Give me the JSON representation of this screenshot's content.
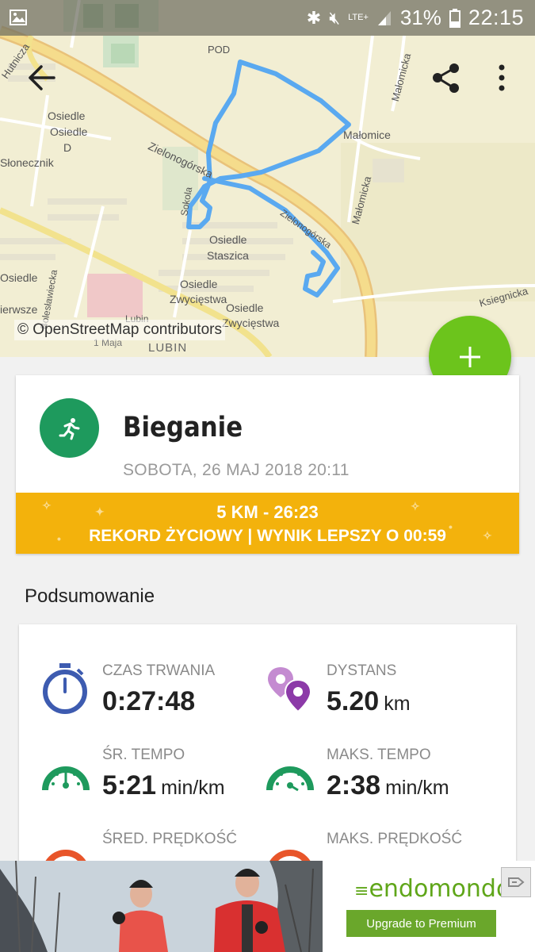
{
  "status_bar": {
    "network": "LTE+",
    "battery": "31%",
    "time": "22:15"
  },
  "map": {
    "labels": [
      {
        "text": "POD"
      },
      {
        "text": "Hutnicza"
      },
      {
        "text": "Osiedle"
      },
      {
        "text": "Osiedle"
      },
      {
        "text": "D"
      },
      {
        "text": "Słonecznik"
      },
      {
        "text": "Zielonogórska"
      },
      {
        "text": "Małomicka"
      },
      {
        "text": "Małomice"
      },
      {
        "text": "Małomicka"
      },
      {
        "text": "Sokola"
      },
      {
        "text": "Osiedle"
      },
      {
        "text": "Staszica"
      },
      {
        "text": "Zielonogórska"
      },
      {
        "text": "Osiedle"
      },
      {
        "text": "ierwsze"
      },
      {
        "text": "Osiedle"
      },
      {
        "text": "Zwycięstwa"
      },
      {
        "text": "Osiedle"
      },
      {
        "text": "Zwycięstwa"
      },
      {
        "text": "Bolesławiecka"
      },
      {
        "text": "Ksiegnicka"
      },
      {
        "text": "Lubin"
      },
      {
        "text": "1 Maja"
      },
      {
        "text": "LUBIN"
      }
    ],
    "attribution": "© OpenStreetMap contributors"
  },
  "workout": {
    "sport": "Bieganie",
    "date": "SOBOTA, 26 MAJ 2018 20:11",
    "record_line1": "5 KM  -  26:23",
    "record_line2": "REKORD ŻYCIOWY  |  WYNIK LEPSZY O 00:59"
  },
  "summary": {
    "title": "Podsumowanie",
    "stats": [
      {
        "label": "CZAS TRWANIA",
        "value": "0:27:48",
        "unit": "",
        "icon": "stopwatch-icon"
      },
      {
        "label": "DYSTANS",
        "value": "5.20",
        "unit": "km",
        "icon": "distance-pins-icon"
      },
      {
        "label": "ŚR. TEMPO",
        "value": "5:21",
        "unit": "min/km",
        "icon": "avg-pace-gauge-icon"
      },
      {
        "label": "MAKS. TEMPO",
        "value": "2:38",
        "unit": "min/km",
        "icon": "max-pace-gauge-icon"
      },
      {
        "label": "ŚRED. PRĘDKOŚĆ",
        "value": "",
        "unit": "",
        "icon": "avg-speed-gauge-icon"
      },
      {
        "label": "MAKS. PRĘDKOŚĆ",
        "value": "",
        "unit": "",
        "icon": "max-speed-gauge-icon"
      }
    ]
  },
  "ad": {
    "brand": "endomondo",
    "button": "Upgrade to Premium"
  },
  "colors": {
    "route": "#5aa9f0",
    "fab": "#6cc41c",
    "sport_icon": "#1e9a5d",
    "record_band": "#f3b20c"
  }
}
